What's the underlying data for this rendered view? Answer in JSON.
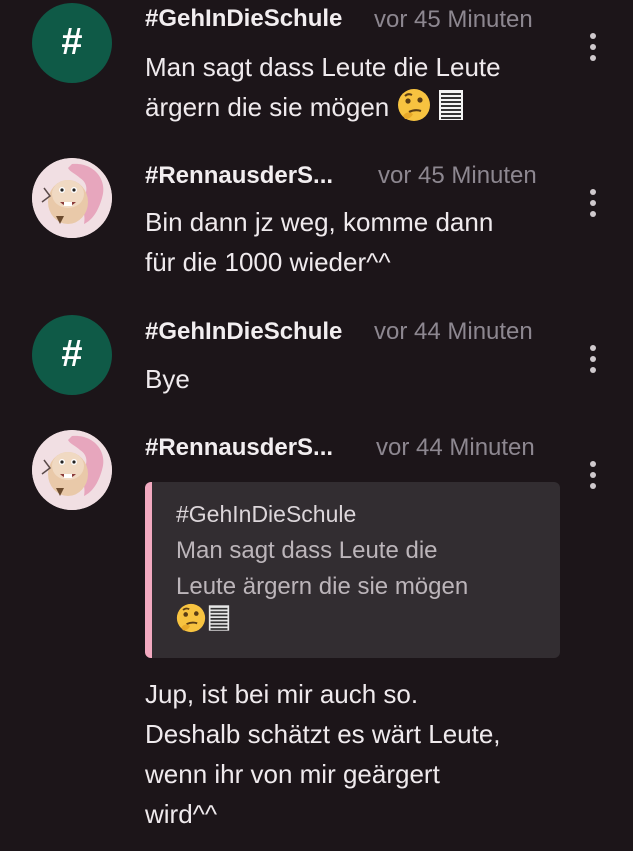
{
  "messages": [
    {
      "user": "#GehInDieSchule",
      "time": "vor 45 Minuten",
      "avatar_type": "hashtag",
      "avatar_glyph": "#",
      "text": "Man sagt dass Leute die Leute ärgern die sie mögen",
      "text_emoji": [
        "thinking-face-icon",
        "page-lines-icon"
      ]
    },
    {
      "user": "#RennausderS...",
      "time": "vor 45 Minuten",
      "avatar_type": "image",
      "text_line1": "Bin dann jz weg, komme dann",
      "text_line2": "für die 1000 wieder^^"
    },
    {
      "user": "#GehInDieSchule",
      "time": "vor 44 Minuten",
      "avatar_type": "hashtag",
      "avatar_glyph": "#",
      "text": "Bye"
    },
    {
      "user": "#RennausderS...",
      "time": "vor 44 Minuten",
      "avatar_type": "image",
      "quote": {
        "user": "#GehInDieSchule",
        "line1": "Man sagt dass Leute die",
        "line2": "Leute ärgern die sie mögen"
      },
      "reply_line1": "Jup, ist bei mir auch so.",
      "reply_line2": "Deshalb schätzt es wärt Leute,",
      "reply_line3": "wenn ihr von mir geärgert",
      "reply_line4": "wird^^"
    }
  ],
  "colors": {
    "background": "#1c1519",
    "hash_avatar": "#0f5a47",
    "quote_bar": "#f2a9c0",
    "quote_bg": "#322d31",
    "timestamp": "#8d8790"
  }
}
